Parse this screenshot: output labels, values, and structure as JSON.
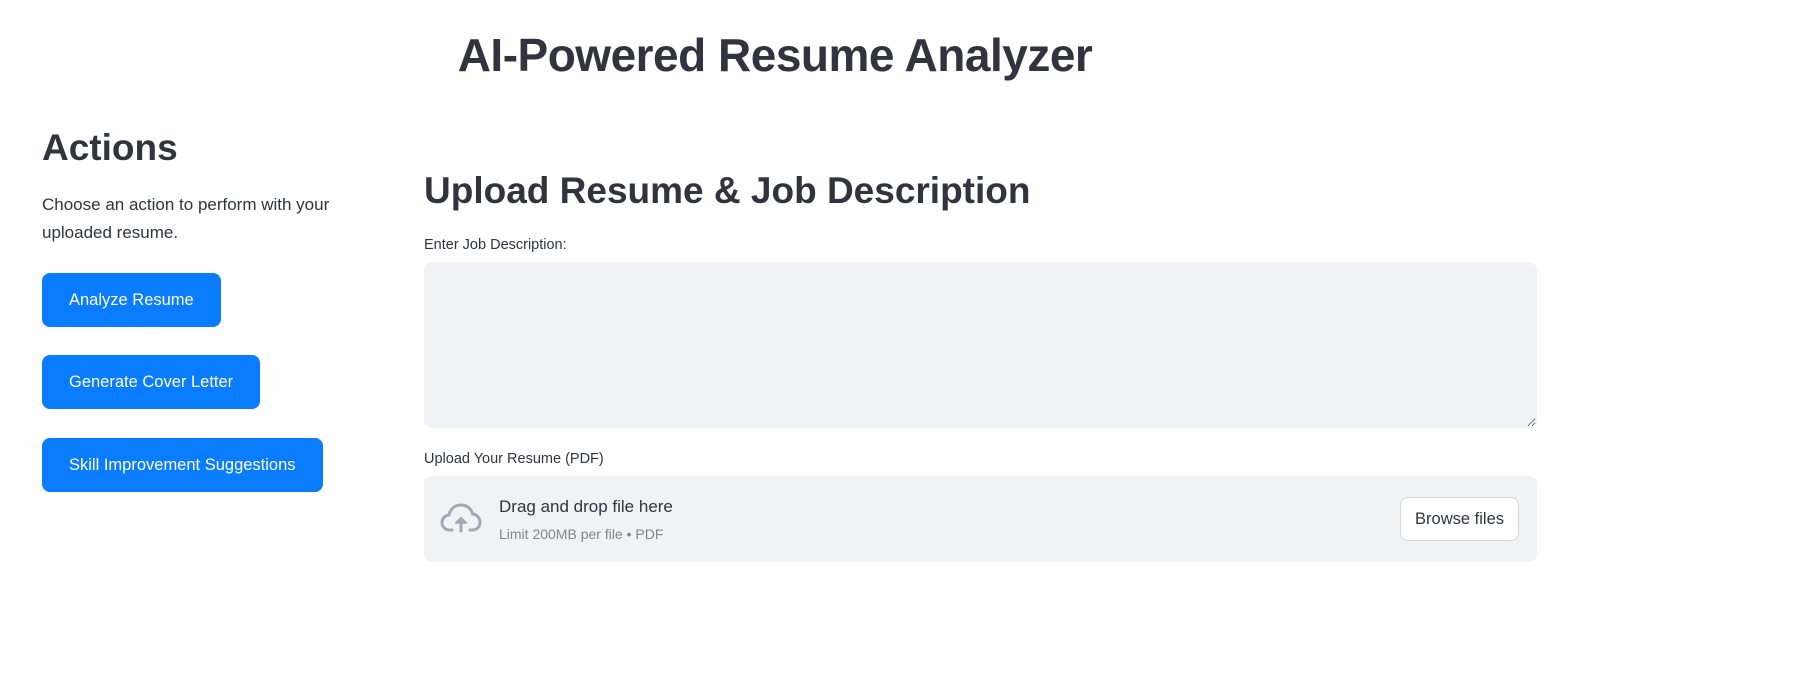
{
  "app": {
    "title": "AI-Powered Resume Analyzer"
  },
  "actions": {
    "heading": "Actions",
    "description": "Choose an action to perform with your uploaded resume.",
    "buttons": {
      "analyze": "Analyze Resume",
      "cover_letter": "Generate Cover Letter",
      "skill_suggestions": "Skill Improvement Suggestions"
    }
  },
  "main": {
    "heading": "Upload Resume & Job Description",
    "job_description": {
      "label": "Enter Job Description:",
      "value": "",
      "placeholder": ""
    },
    "resume_upload": {
      "label": "Upload Your Resume (PDF)",
      "drop_title": "Drag and drop file here",
      "drop_subtitle": "Limit 200MB per file • PDF",
      "browse_label": "Browse files",
      "icon": "cloud-upload-icon"
    }
  },
  "colors": {
    "primary_button": "#0a7cff",
    "text": "#31333f",
    "input_background": "#f0f2f6",
    "muted_text": "#808495",
    "icon": "#a3a8b8"
  }
}
